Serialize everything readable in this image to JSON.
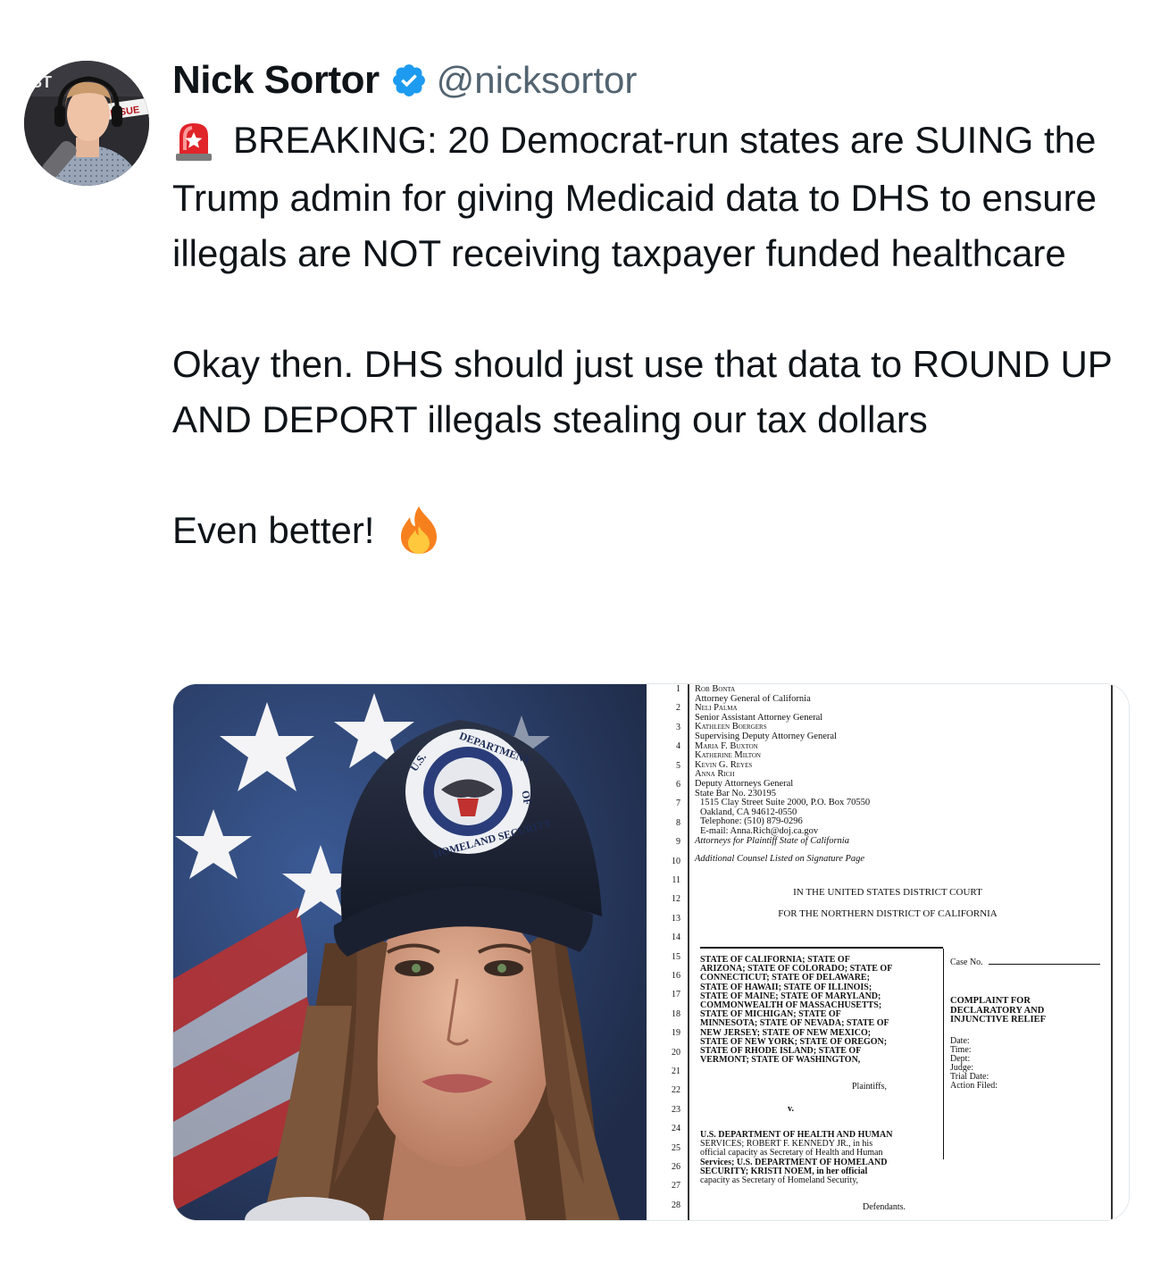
{
  "author": {
    "name": "Nick Sortor",
    "handle": "@nicksortor",
    "verified": true
  },
  "tweet": {
    "line1": "BREAKING: 20 Democrat-run states are SUING the Trump admin for giving Medicaid data to DHS to ensure illegals are NOT receiving taxpayer funded healthcare",
    "line2": "Okay then. DHS should just use that data to ROUND UP AND DEPORT illegals stealing our tax dollars",
    "line3": "Even better!",
    "icons": [
      "siren-emoji",
      "fire-emoji"
    ]
  },
  "avatar_text": {
    "logo": "ST",
    "banner": "ISSUE"
  },
  "media": {
    "photo": {
      "cap_text_top": "DEPARTMENT",
      "cap_text_right": "OF",
      "cap_text_bottom": "HOMELAND SECURITY",
      "cap_text_left": "U.S."
    },
    "document": {
      "line_numbers": [
        "1",
        "2",
        "3",
        "4",
        "5",
        "6",
        "7",
        "8",
        "9",
        "10",
        "11",
        "12",
        "13",
        "14",
        "15",
        "16",
        "17",
        "18",
        "19",
        "20",
        "21",
        "22",
        "23",
        "24",
        "25",
        "26",
        "27",
        "28"
      ],
      "counsel": [
        "Rob Bonta",
        "Attorney General of California",
        "Neli Palma",
        "Senior Assistant Attorney General",
        "Kathleen Boergers",
        "Supervising Deputy Attorney General",
        "Maria F. Buxton",
        "Katherine Milton",
        "Kevin G. Reyes",
        "Anna Rich",
        "Deputy Attorneys General",
        "State Bar No. 230195",
        "1515 Clay Street Suite 2000, P.O. Box 70550",
        "Oakland, CA 94612-0550",
        "Telephone: (510) 879-0296",
        "E-mail: Anna.Rich@doj.ca.gov",
        "Attorneys for Plaintiff State of California"
      ],
      "additional_counsel": "Additional Counsel Listed on Signature Page",
      "court_line1": "IN THE UNITED STATES DISTRICT COURT",
      "court_line2": "FOR THE NORTHERN DISTRICT OF CALIFORNIA",
      "plaintiffs": [
        "STATE OF CALIFORNIA; STATE OF",
        "ARIZONA; STATE OF COLORADO; STATE OF",
        "CONNECTICUT; STATE OF DELAWARE;",
        "STATE OF HAWAII; STATE OF ILLINOIS;",
        "STATE OF MAINE; STATE OF MARYLAND;",
        "COMMONWEALTH OF MASSACHUSETTS;",
        "STATE OF MICHIGAN; STATE OF",
        "MINNESOTA; STATE OF NEVADA; STATE OF",
        "NEW JERSEY; STATE OF NEW MEXICO;",
        "STATE OF NEW YORK; STATE OF OREGON;",
        "STATE OF RHODE ISLAND; STATE OF",
        "VERMONT; STATE OF WASHINGTON,"
      ],
      "plaintiffs_label": "Plaintiffs,",
      "versus": "v.",
      "defendants": [
        "U.S. DEPARTMENT OF HEALTH AND HUMAN",
        "SERVICES; ROBERT F. KENNEDY JR., in his",
        "official capacity as Secretary of Health and Human",
        "Services; U.S. DEPARTMENT OF HOMELAND",
        "SECURITY; KRISTI NOEM, in her official",
        "capacity as Secretary of Homeland Security,"
      ],
      "defendants_label": "Defendants.",
      "case_no": "Case No.",
      "complaint": [
        "COMPLAINT FOR",
        "DECLARATORY AND",
        "INJUNCTIVE RELIEF"
      ],
      "meta": [
        "Date:",
        "Time:",
        "Dept:",
        "Judge:",
        "Trial Date:",
        "Action Filed:"
      ]
    }
  },
  "colors": {
    "text": "#0f1419",
    "handle": "#536471",
    "verified": "#1d9bf0"
  }
}
